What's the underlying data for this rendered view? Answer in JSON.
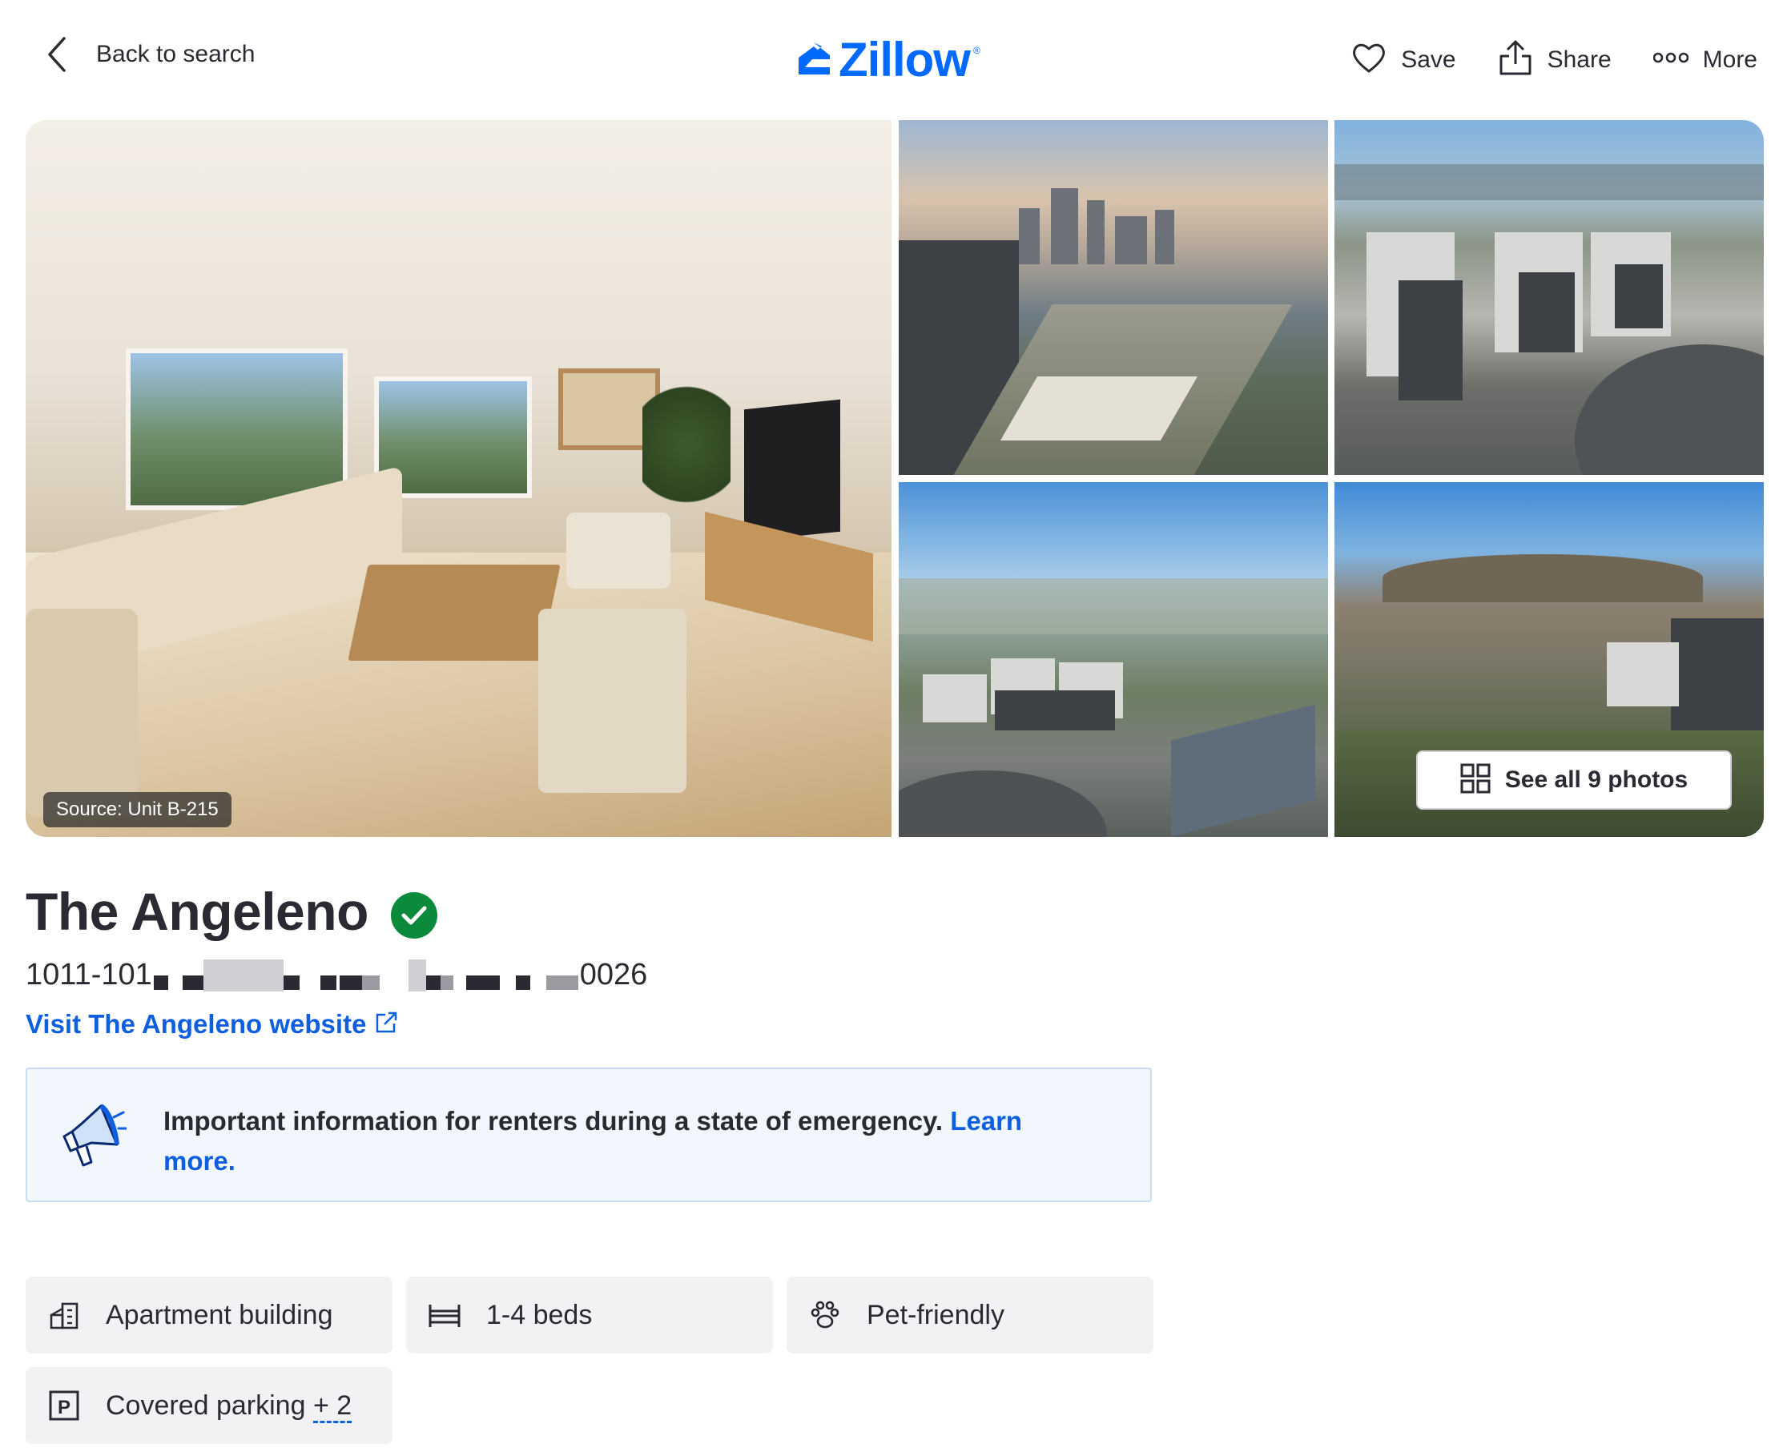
{
  "header": {
    "back_label": "Back to search",
    "logo_text": "Zillow",
    "logo_mark": "®",
    "actions": [
      {
        "label": "Save",
        "icon": "heart-icon"
      },
      {
        "label": "Share",
        "icon": "share-icon"
      },
      {
        "label": "More",
        "icon": "more-icon"
      }
    ]
  },
  "gallery": {
    "source_tag": "Source: Unit B-215",
    "see_all_label": "See all 9 photos",
    "photos": [
      "living-room",
      "rooftop-downtown-view",
      "aerial-buildings",
      "aerial-neighborhood",
      "aerial-hollywood-hills"
    ]
  },
  "listing": {
    "name": "The Angeleno",
    "verified_icon": "verified-check-icon",
    "address_start": "1011-101",
    "address_end": "0026",
    "website_label": "Visit The Angeleno website"
  },
  "notice": {
    "text": "Important information for renters during a state of emergency.",
    "link": "Learn more."
  },
  "features": [
    {
      "label": "Apartment building",
      "icon": "building-icon"
    },
    {
      "label": "1-4 beds",
      "icon": "bed-icon"
    },
    {
      "label": "Pet-friendly",
      "icon": "paw-icon"
    },
    {
      "label": "Covered parking",
      "extra": "+ 2",
      "icon": "parking-icon"
    }
  ],
  "colors": {
    "brand": "#006aff",
    "link": "#0d5fe0",
    "verified": "#0a8a3a",
    "text": "#2a2a33",
    "notice_bg": "#f1f7fd",
    "chip_bg": "#f2f2f5"
  }
}
